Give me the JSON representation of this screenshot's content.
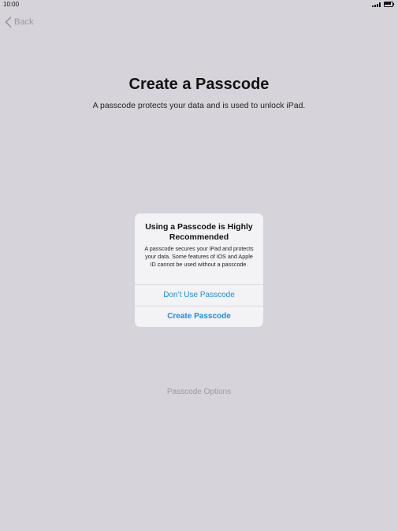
{
  "status_bar": {
    "time": "10:00",
    "signal_icon": "cellular-signal-icon",
    "battery_icon": "battery-icon"
  },
  "nav": {
    "back_label": "Back",
    "back_icon": "chevron-left-icon"
  },
  "main": {
    "title": "Create a Passcode",
    "subtitle": "A passcode protects your data and is used to unlock iPad.",
    "options_link": "Passcode Options"
  },
  "alert": {
    "title": "Using a Passcode is Highly Recommended",
    "message": "A passcode secures your iPad and protects your data. Some features of iOS and Apple ID cannot be used without a passcode.",
    "buttons": [
      {
        "label": "Don’t Use Passcode"
      },
      {
        "label": "Create Passcode"
      }
    ]
  },
  "colors": {
    "background": "#d6d4da",
    "alert_background": "#f3f2f5",
    "accent": "#1a8ee0",
    "muted": "#9b9aa0"
  }
}
